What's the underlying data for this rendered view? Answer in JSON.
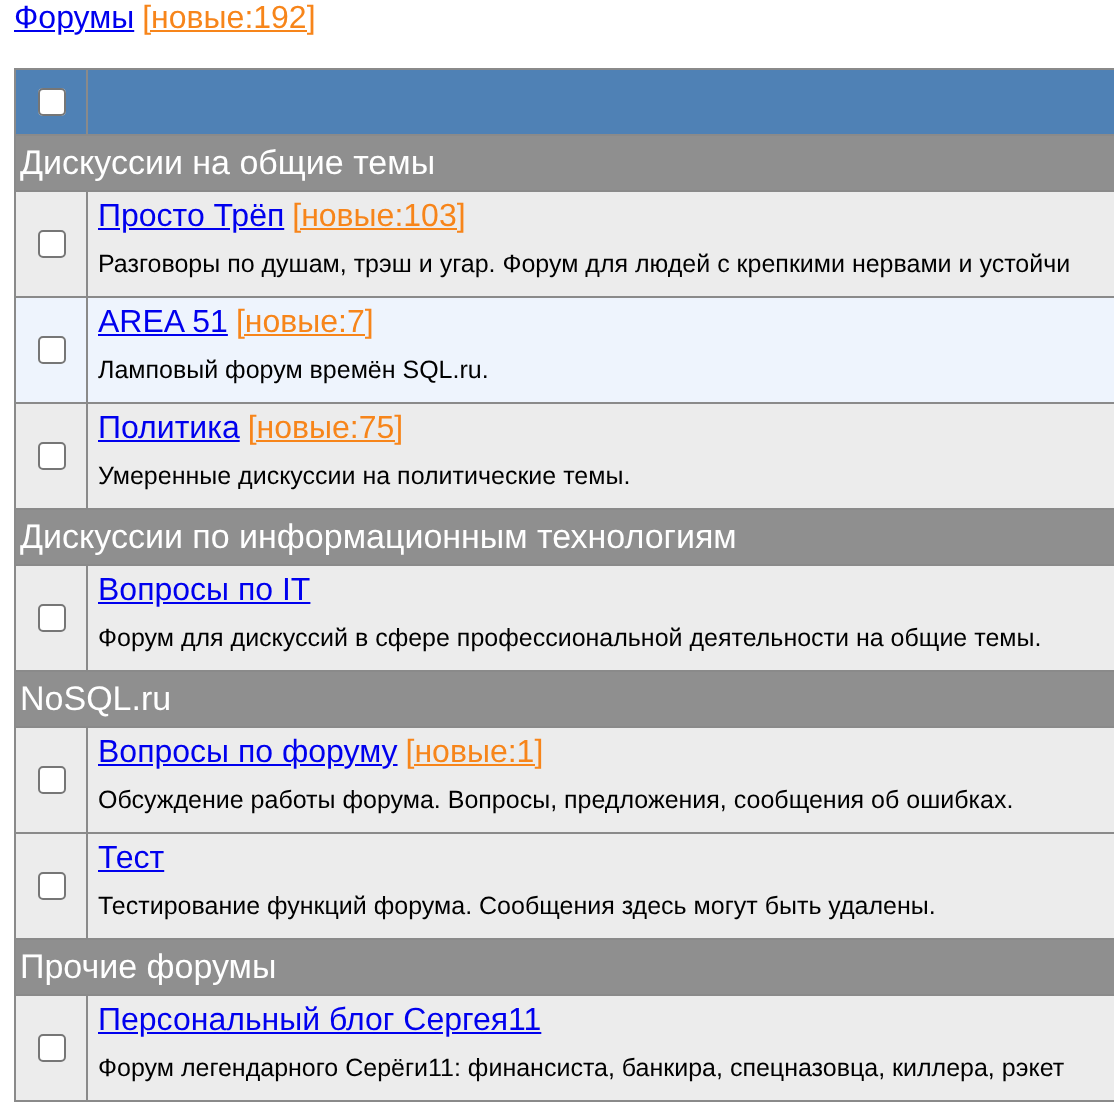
{
  "breadcrumb": {
    "link": "Форумы",
    "new_badge": "[новые:192]"
  },
  "header": {
    "checked": false
  },
  "sections": [
    {
      "title": "Дискуссии на общие темы",
      "forums": [
        {
          "name": "Просто Трёп",
          "new_badge": "[новые:103]",
          "description": "Разговоры по душам, трэш и угар. Форум для людей с крепкими нервами и устойчи",
          "checked": false,
          "highlighted": false
        },
        {
          "name": "AREA 51",
          "new_badge": "[новые:7]",
          "description": "Ламповый форум времён SQL.ru.",
          "checked": false,
          "highlighted": true
        },
        {
          "name": "Политика",
          "new_badge": "[новые:75]",
          "description": "Умеренные дискуссии на политические темы.",
          "checked": false,
          "highlighted": false
        }
      ]
    },
    {
      "title": "Дискуссии по информационным технологиям",
      "forums": [
        {
          "name": "Вопросы по IT",
          "description": "Форум для дискуссий в сфере профессиональной деятельности на общие темы.",
          "checked": false,
          "highlighted": false
        }
      ]
    },
    {
      "title": "NoSQL.ru",
      "forums": [
        {
          "name": "Вопросы по форуму",
          "new_badge": "[новые:1]",
          "description": "Обсуждение работы форума. Вопросы, предложения, сообщения об ошибках.",
          "checked": false,
          "highlighted": false
        },
        {
          "name": "Тест",
          "description": "Тестирование функций форума. Сообщения здесь могут быть удалены.",
          "checked": false,
          "highlighted": false
        }
      ]
    },
    {
      "title": "Прочие форумы",
      "forums": [
        {
          "name": "Персональный блог Сергея11",
          "description": "Форум легендарного Серёги11: финансиста, банкира, спецназовца, киллера, рэкет",
          "checked": false,
          "highlighted": false
        }
      ]
    }
  ]
}
